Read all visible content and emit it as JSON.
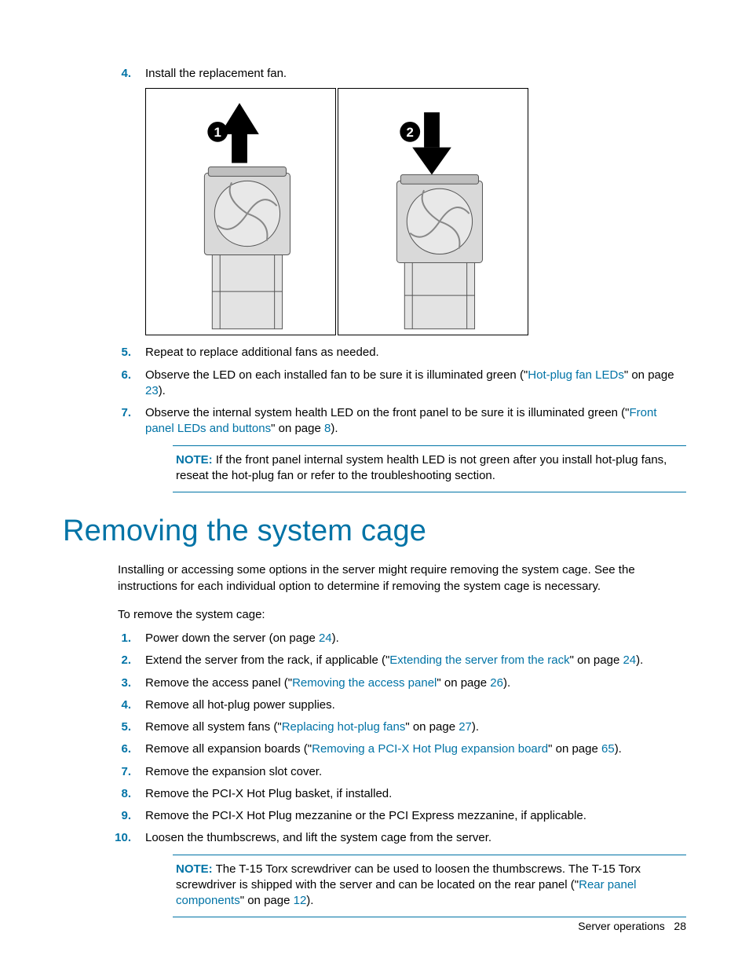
{
  "steps_top": {
    "s4": {
      "num": "4.",
      "text": "Install the replacement fan."
    },
    "s5": {
      "num": "5.",
      "text": "Repeat to replace additional fans as needed."
    },
    "s6": {
      "num": "6.",
      "pre": "Observe the LED on each installed fan to be sure it is illuminated green (\"",
      "link": "Hot-plug fan LEDs",
      "mid": "\" on page ",
      "page": "23",
      "post": ")."
    },
    "s7": {
      "num": "7.",
      "pre": "Observe the internal system health LED on the front panel to be sure it is illuminated green (\"",
      "link": "Front panel LEDs and buttons",
      "mid": "\" on page ",
      "page": "8",
      "post": ")."
    }
  },
  "note_top": {
    "label": "NOTE:",
    "text": "  If the front panel internal system health LED is not green after you install hot-plug fans, reseat the hot-plug fan or refer to the troubleshooting section."
  },
  "heading": "Removing the system cage",
  "intro": "Installing or accessing some options in the server might require removing the system cage. See the instructions for each individual option to determine if removing the system cage is necessary.",
  "lead": "To remove the system cage:",
  "steps_bottom": {
    "s1": {
      "num": "1.",
      "pre": "Power down the server (on page ",
      "page": "24",
      "post": ")."
    },
    "s2": {
      "num": "2.",
      "pre": "Extend the server from the rack, if applicable (\"",
      "link": "Extending the server from the rack",
      "mid": "\" on page ",
      "page": "24",
      "post": ")."
    },
    "s3": {
      "num": "3.",
      "pre": "Remove the access panel (\"",
      "link": "Removing the access panel",
      "mid": "\" on page ",
      "page": "26",
      "post": ")."
    },
    "s4": {
      "num": "4.",
      "text": "Remove all hot-plug power supplies."
    },
    "s5": {
      "num": "5.",
      "pre": "Remove all system fans (\"",
      "link": "Replacing hot-plug fans",
      "mid": "\" on page ",
      "page": "27",
      "post": ")."
    },
    "s6": {
      "num": "6.",
      "pre": "Remove all expansion boards (\"",
      "link": "Removing a PCI-X Hot Plug expansion board",
      "mid": "\" on page ",
      "page": "65",
      "post": ")."
    },
    "s7": {
      "num": "7.",
      "text": "Remove the expansion slot cover."
    },
    "s8": {
      "num": "8.",
      "text": "Remove the PCI-X Hot Plug basket, if installed."
    },
    "s9": {
      "num": "9.",
      "text": "Remove the PCI-X Hot Plug mezzanine or the PCI Express mezzanine, if applicable."
    },
    "s10": {
      "num": "10.",
      "text": "Loosen the thumbscrews, and lift the system cage from the server."
    }
  },
  "note_bottom": {
    "label": "NOTE:",
    "pre": "  The T-15 Torx screwdriver can be used to loosen the thumbscrews. The T-15 Torx screwdriver is shipped with the server and can be located on the rear panel (\"",
    "link": "Rear panel components",
    "mid": "\" on page ",
    "page": "12",
    "post": ")."
  },
  "footer": {
    "section": "Server operations",
    "page": "28"
  },
  "figure": {
    "badge1": "1",
    "badge2": "2"
  }
}
